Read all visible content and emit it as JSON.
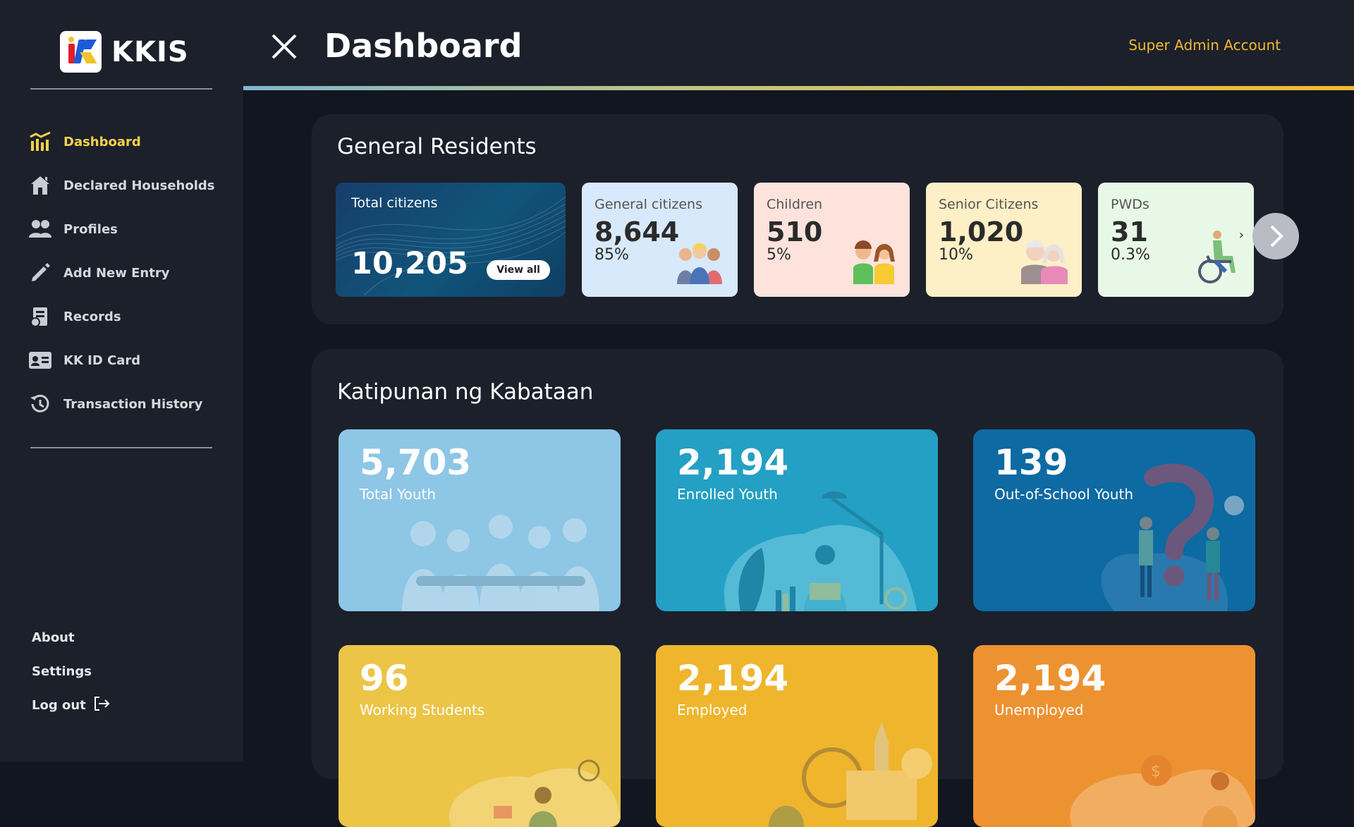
{
  "brand": {
    "name": "KKIS"
  },
  "sidebar": {
    "items": [
      {
        "label": "Dashboard",
        "icon": "chart-icon",
        "active": true
      },
      {
        "label": "Declared Households",
        "icon": "house-icon",
        "active": false
      },
      {
        "label": "Profiles",
        "icon": "people-icon",
        "active": false
      },
      {
        "label": "Add New Entry",
        "icon": "pencil-icon",
        "active": false
      },
      {
        "label": "Records",
        "icon": "records-icon",
        "active": false
      },
      {
        "label": "KK ID Card",
        "icon": "id-card-icon",
        "active": false
      },
      {
        "label": "Transaction History",
        "icon": "history-icon",
        "active": false
      }
    ],
    "bottom": {
      "about": "About",
      "settings": "Settings",
      "logout": "Log out"
    }
  },
  "header": {
    "title": "Dashboard",
    "account": "Super Admin Account"
  },
  "general_residents": {
    "title": "General Residents",
    "total": {
      "label": "Total citizens",
      "value": "10,205",
      "button": "View all"
    },
    "cards": [
      {
        "label": "General citizens",
        "value": "8,644",
        "pct": "85%",
        "bg": "#d7e9fb"
      },
      {
        "label": "Children",
        "value": "510",
        "pct": "5%",
        "bg": "#fde3dc"
      },
      {
        "label": "Senior Citizens",
        "value": "1,020",
        "pct": "10%",
        "bg": "#fdefc6"
      },
      {
        "label": "PWDs",
        "value": "31",
        "pct": "0.3%",
        "bg": "#e8f8e6"
      }
    ]
  },
  "kabataan": {
    "title": "Katipunan ng Kabataan",
    "cards": [
      {
        "value": "5,703",
        "label": "Total Youth",
        "bg": "#8ec6e6"
      },
      {
        "value": "2,194",
        "label": "Enrolled Youth",
        "bg": "#23a0c4"
      },
      {
        "value": "139",
        "label": "Out-of-School Youth",
        "bg": "#0d6aa2"
      },
      {
        "value": "96",
        "label": "Working Students",
        "bg": "#ecc547"
      },
      {
        "value": "2,194",
        "label": "Employed",
        "bg": "#efb52c"
      },
      {
        "value": "2,194",
        "label": "Unemployed",
        "bg": "#ed9231"
      }
    ]
  },
  "colors": {
    "accent": "#f6d24a",
    "account": "#f5b731",
    "panel": "#1b202b",
    "background": "#121620"
  }
}
